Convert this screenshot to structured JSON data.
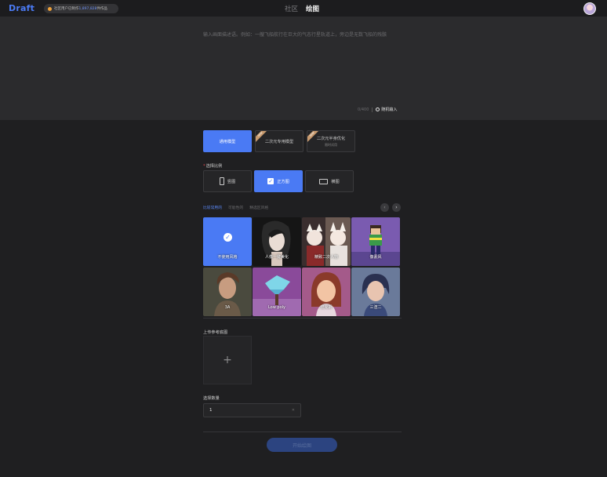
{
  "app": {
    "logo": "Draft"
  },
  "notice": {
    "prefix": "社区用户已制作",
    "highlight": "1,897,828",
    "suffix": "件作品"
  },
  "nav": {
    "tabs": [
      "社区",
      "绘图"
    ],
    "active": "绘图"
  },
  "prompt": {
    "placeholder": "输入画面描述语。例如：一艘飞船航行在巨大的气态行星轨道上，旁边是无数飞船的残骸",
    "counter": "0/400",
    "random_label": "随机输入"
  },
  "models": [
    {
      "label": "通用模型",
      "sub": "",
      "active": true,
      "badge": ""
    },
    {
      "label": "二次元专用模型",
      "sub": "",
      "active": false,
      "badge": "NEW"
    },
    {
      "label": "二次元半身优化",
      "sub": "限时试用",
      "active": false,
      "badge": "NEW"
    }
  ],
  "ratio": {
    "label": "选择比例",
    "options": [
      {
        "label": "竖图",
        "shape": "vertical",
        "active": false
      },
      {
        "label": "正方图",
        "shape": "check",
        "active": true
      },
      {
        "label": "横图",
        "shape": "horizontal",
        "active": false
      }
    ]
  },
  "style_tabs": [
    "比较常用的",
    "可能性的",
    "精选区风格"
  ],
  "styles": [
    {
      "label": "不使用风格",
      "kind": "none"
    },
    {
      "label": "人像一键美化",
      "kind": "portrait"
    },
    {
      "label": "精致二次人物",
      "kind": "anime"
    },
    {
      "label": "像素风",
      "kind": "pixel"
    },
    {
      "label": "3A",
      "kind": "3a"
    },
    {
      "label": "Low poly",
      "kind": "lowpoly"
    },
    {
      "label": "皮克斯",
      "kind": "pixar"
    },
    {
      "label": "三渲二",
      "kind": "toon"
    }
  ],
  "upload": {
    "label": "上传参考底图",
    "plus": "+"
  },
  "quantity": {
    "label": "选择数量",
    "value": "1",
    "clear": "✕"
  },
  "start_button": "开始绘图",
  "colors": {
    "accent": "#4a7af4",
    "background": "#1f1f21",
    "panel": "#2b2b2d"
  }
}
